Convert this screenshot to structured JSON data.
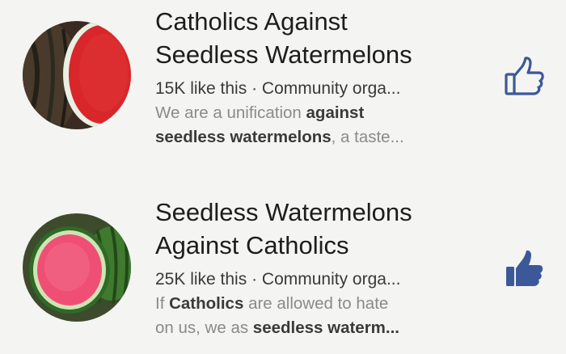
{
  "results": [
    {
      "title_line1": "Catholics Against",
      "title_line2": "Seedless Watermelons",
      "likes": "15K like this",
      "separator": " · ",
      "category": "Community orga...",
      "desc_line1_a": "We are a unification ",
      "desc_line1_b": "against",
      "desc_line2_a": "seedless watermelons",
      "desc_line2_b": ", a taste...",
      "liked": false,
      "like_icon": "thumbs-up-outline-icon",
      "avatar": "watermelon-slice-icon"
    },
    {
      "title_line1": "Seedless Watermelons",
      "title_line2": "Against Catholics",
      "likes": "25K like this",
      "separator": " · ",
      "category": "Community orga...",
      "desc_line1_a": "If ",
      "desc_line1_b": "Catholics",
      "desc_line1_c": " are allowed to hate",
      "desc_line2_a": "on us, we as ",
      "desc_line2_b": "seedless waterm...",
      "liked": true,
      "like_icon": "thumbs-up-filled-icon",
      "avatar": "seedless-watermelon-icon"
    }
  ],
  "colors": {
    "background": "#f4f4f2",
    "like_active": "#3b5998",
    "like_inactive": "#3b5998"
  }
}
